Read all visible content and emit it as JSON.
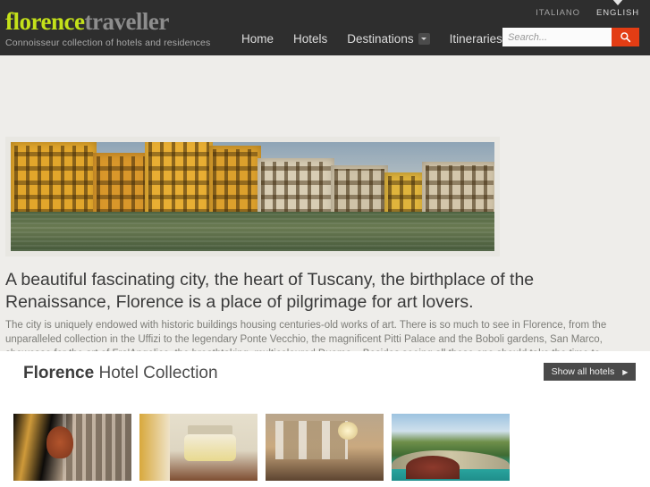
{
  "header": {
    "logo": {
      "part1": "florence",
      "part2": "traveller"
    },
    "tagline": "Connoisseur collection of hotels and residences",
    "nav": [
      {
        "label": "Home",
        "has_dropdown": false
      },
      {
        "label": "Hotels",
        "has_dropdown": false
      },
      {
        "label": "Destinations",
        "has_dropdown": true
      },
      {
        "label": "Itineraries",
        "has_dropdown": true
      }
    ],
    "languages": [
      {
        "label": "ITALIANO",
        "active": false
      },
      {
        "label": "ENGLISH",
        "active": true
      }
    ],
    "search": {
      "placeholder": "Search...",
      "value": "",
      "button_icon": "search-icon",
      "button_color": "#e33d14"
    },
    "background_color": "#2e2e2e",
    "logo_accent_color": "#c4e11a"
  },
  "hero": {
    "image_alt": "Ponte Vecchio over the Arno river, Florence"
  },
  "intro": {
    "lede": "A beautiful fascinating city, the heart of Tuscany, the birthplace of the Renaissance, Florence is a place of pilgrimage for art lovers.",
    "body": "The city is uniquely endowed with historic buildings housing centuries-old works of art. There is so much to see in Florence, from the unparalleled collection in the Uffizi to the legendary Ponte Vecchio, the magnificent Pitti Palace and the Boboli gardens, San Marco, showcase for the art of Fra'Angelico, the breathtaking, multicoloured Duomo... Besides seeing all these one should take the time to wander through the paths and allies, along the banks of the Arno, and visit the markets. For the most amazing view of the city climb to San Miniato.",
    "background_color": "#eeedea"
  },
  "collection": {
    "title_strong": "Florence",
    "title_rest": " Hotel Collection",
    "show_all_label": "Show all hotels",
    "show_all_arrow": "▶",
    "thumbnails": [
      {
        "alt": "Duomo illuminated at night seen from a hotel loggia"
      },
      {
        "alt": "Elegant bedroom with gold canopy bed"
      },
      {
        "alt": "Classic salon with chandelier and draped windows"
      },
      {
        "alt": "Swimming pool overlooking the Tuscan countryside"
      }
    ]
  }
}
